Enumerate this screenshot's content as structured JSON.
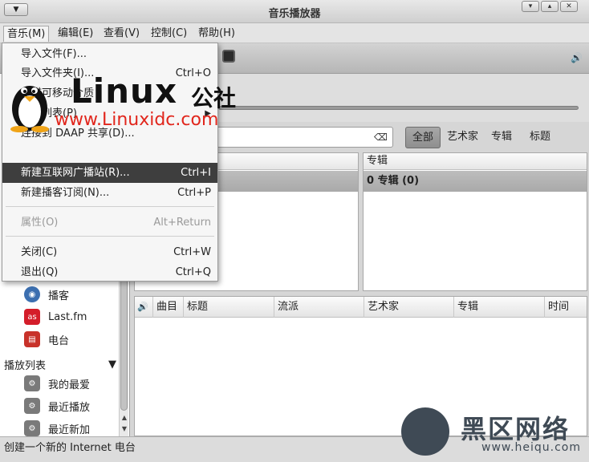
{
  "window": {
    "title": "音乐播放器"
  },
  "menubar": [
    {
      "label": "音乐(M)"
    },
    {
      "label": "编辑(E)"
    },
    {
      "label": "查看(V)"
    },
    {
      "label": "控制(C)"
    },
    {
      "label": "帮助(H)"
    }
  ],
  "music_menu": {
    "items": [
      {
        "label": "导入文件(F)...",
        "accel": ""
      },
      {
        "label": "导入文件夹(I)...",
        "accel": "Ctrl+O"
      },
      {
        "label": "扫描可移动介质",
        "accel": ""
      },
      {
        "label": "播放列表(P)",
        "accel": ""
      },
      {
        "label": "连接到 DAAP 共享(D)...",
        "accel": ""
      },
      {
        "label": "新建互联网广播站(R)...",
        "accel": "Ctrl+I"
      },
      {
        "label": "新建播客订阅(N)...",
        "accel": "Ctrl+P"
      },
      {
        "label": "属性(O)",
        "accel": "Alt+Return"
      },
      {
        "label": "关闭(C)",
        "accel": "Ctrl+W"
      },
      {
        "label": "退出(Q)",
        "accel": "Ctrl+Q"
      }
    ]
  },
  "sidebar": {
    "sources": [
      {
        "label": "播客",
        "icon": "podcast-icon"
      },
      {
        "label": "Last.fm",
        "icon": "lastfm-icon"
      },
      {
        "label": "电台",
        "icon": "radio-icon"
      }
    ],
    "playlists_header": "播放列表",
    "playlists": [
      {
        "label": "我的最爱",
        "icon": "gear-icon"
      },
      {
        "label": "最近播放",
        "icon": "gear-icon"
      },
      {
        "label": "最近新加",
        "icon": "gear-icon"
      }
    ]
  },
  "browser": {
    "filters": [
      "全部",
      "艺术家",
      "专辑",
      "标题"
    ],
    "album_pane": {
      "header": "专辑",
      "selected": "0 专辑 (0)"
    }
  },
  "tracklist": {
    "columns": [
      "曲目",
      "标题",
      "流派",
      "艺术家",
      "专辑",
      "时间"
    ]
  },
  "statusbar": {
    "text": "创建一个新的 Internet 电台"
  },
  "watermarks": {
    "linux": "Linux",
    "gongshe": "公社",
    "linux_url": "www.Linuxidc.com",
    "heiqu": "黑区网络",
    "heiqu_url": "www.heiqu.com"
  }
}
